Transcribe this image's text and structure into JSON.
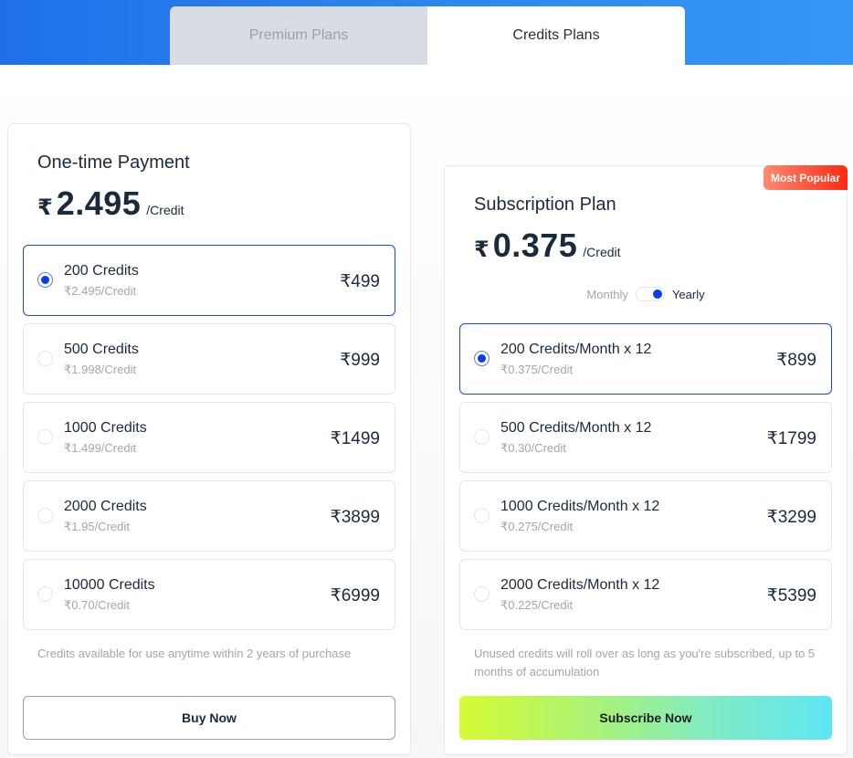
{
  "tabs": [
    {
      "label": "Premium Plans",
      "active": false
    },
    {
      "label": "Credits Plans",
      "active": true
    }
  ],
  "one_time": {
    "title": "One-time Payment",
    "currency": "₹",
    "price": "2.495",
    "unit": "/Credit",
    "options": [
      {
        "name": "200 Credits",
        "rate": "₹2.495/Credit",
        "price": "₹499",
        "selected": true
      },
      {
        "name": "500 Credits",
        "rate": "₹1.998/Credit",
        "price": "₹999",
        "selected": false
      },
      {
        "name": "1000 Credits",
        "rate": "₹1.499/Credit",
        "price": "₹1499",
        "selected": false
      },
      {
        "name": "2000 Credits",
        "rate": "₹1.95/Credit",
        "price": "₹3899",
        "selected": false
      },
      {
        "name": "10000 Credits",
        "rate": "₹0.70/Credit",
        "price": "₹6999",
        "selected": false
      }
    ],
    "note": "Credits available for use anytime within 2 years of purchase",
    "button_label": "Buy Now"
  },
  "subscription": {
    "badge": "Most Popular",
    "title": "Subscription Plan",
    "currency": "₹",
    "price": "0.375",
    "unit": "/Credit",
    "billing_toggle": {
      "off_label": "Monthly",
      "on_label": "Yearly",
      "selected": "Yearly"
    },
    "options": [
      {
        "name": "200 Credits/Month x 12",
        "rate": "₹0.375/Credit",
        "price": "₹899",
        "selected": true
      },
      {
        "name": "500 Credits/Month x 12",
        "rate": "₹0.30/Credit",
        "price": "₹1799",
        "selected": false
      },
      {
        "name": "1000 Credits/Month x 12",
        "rate": "₹0.275/Credit",
        "price": "₹3299",
        "selected": false
      },
      {
        "name": "2000 Credits/Month x 12",
        "rate": "₹0.225/Credit",
        "price": "₹5399",
        "selected": false
      }
    ],
    "note": "Unused credits will roll over as long as you're subscribed, up to 5 months of accumulation",
    "button_label": "Subscribe Now"
  }
}
